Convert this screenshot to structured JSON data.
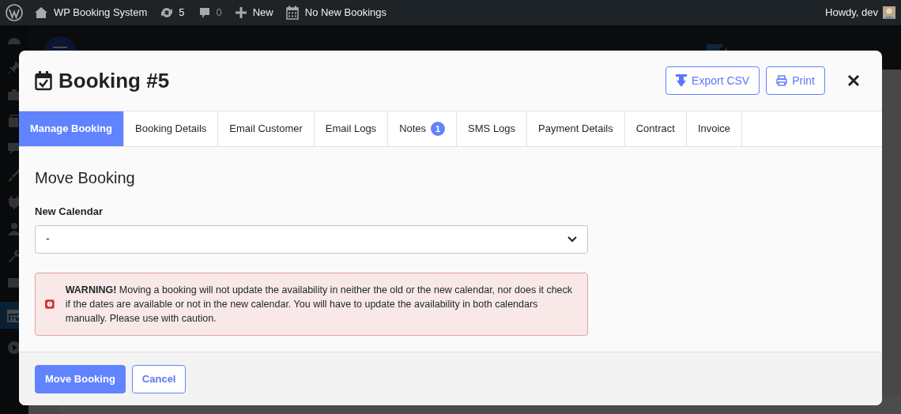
{
  "admin_bar": {
    "site": "WP Booking System",
    "updates": "5",
    "comments": "0",
    "new": "New",
    "bookings": "No New Bookings",
    "greeting": "Howdy, dev"
  },
  "modal": {
    "title": "Booking #5",
    "actions": [
      {
        "label": "Export CSV",
        "kind": "export"
      },
      {
        "label": "Print",
        "kind": "print"
      }
    ],
    "tabs": [
      {
        "label": "Manage Booking",
        "selected": true
      },
      {
        "label": "Booking Details",
        "selected": false
      },
      {
        "label": "Email Customer",
        "selected": false
      },
      {
        "label": "Email Logs",
        "selected": false
      },
      {
        "label": "Notes",
        "badge": "1",
        "selected": false
      },
      {
        "label": "SMS Logs",
        "selected": false
      },
      {
        "label": "Payment Details",
        "selected": false
      },
      {
        "label": "Contract",
        "selected": false
      },
      {
        "label": "Invoice",
        "selected": false
      }
    ],
    "section_title": "Move Booking",
    "field": {
      "label": "New Calendar",
      "value": "-"
    },
    "warning": "**WARNING!** Moving a booking will not update the availability in neither the old or the new calendar, nor does it check if the dates are available or not in the new calendar. You will have to update the availability in both calendars manually. Please use with caution.",
    "footer_buttons": [
      {
        "label": "Move Booking",
        "kind": "primary"
      },
      {
        "label": "Cancel",
        "kind": "secondary"
      }
    ]
  }
}
